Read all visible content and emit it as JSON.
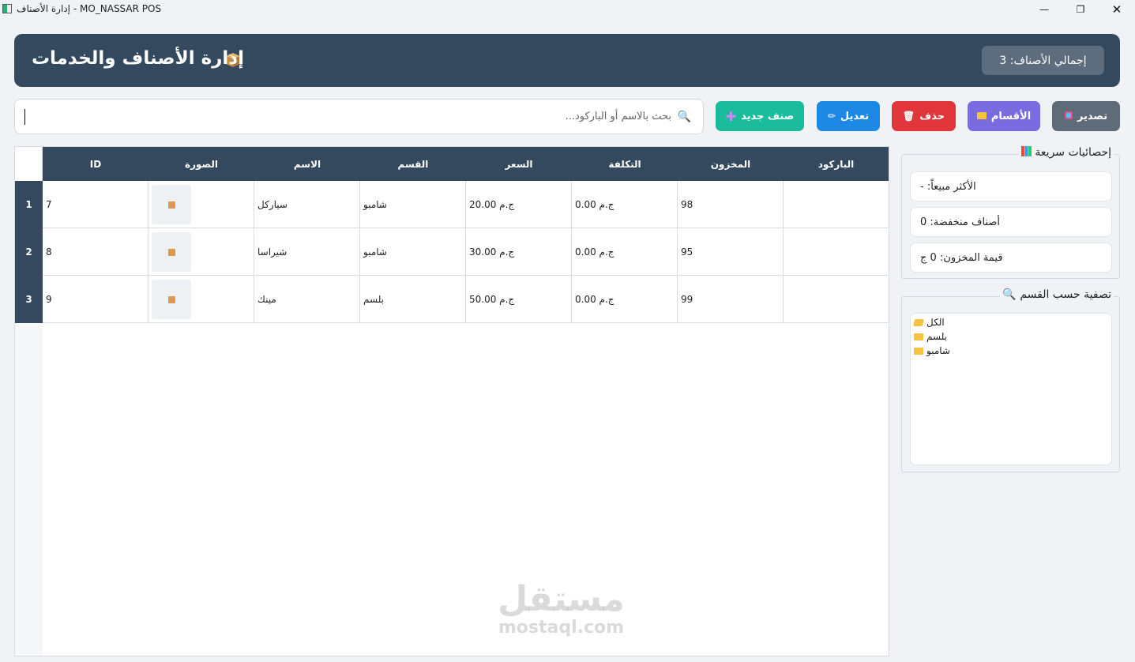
{
  "window": {
    "title": "إدارة الأصناف - MO_NASSAR POS"
  },
  "header": {
    "title": "إدارة الأصناف والخدمات",
    "total_label": "إجمالي الأصناف: 3"
  },
  "toolbar": {
    "search_placeholder": "بحث بالاسم أو الباركود...",
    "new_label": "صنف جديد",
    "edit_label": "تعديل",
    "delete_label": "حذف",
    "categories_label": "الأقسام",
    "export_label": "تصدير"
  },
  "table": {
    "columns": [
      "ID",
      "الصورة",
      "الاسم",
      "القسم",
      "السعر",
      "التكلفة",
      "المخزون",
      "الباركود"
    ],
    "rows": [
      {
        "num": "1",
        "id": "7",
        "name": "سياركل",
        "category": "شامبو",
        "price": "ج.م 20.00",
        "cost": "ج.م 0.00",
        "stock": "98",
        "barcode": ""
      },
      {
        "num": "2",
        "id": "8",
        "name": "شيراسا",
        "category": "شامبو",
        "price": "ج.م 30.00",
        "cost": "ج.م 0.00",
        "stock": "95",
        "barcode": ""
      },
      {
        "num": "3",
        "id": "9",
        "name": "مينك",
        "category": "بلسم",
        "price": "ج.م 50.00",
        "cost": "ج.م 0.00",
        "stock": "99",
        "barcode": ""
      }
    ]
  },
  "stats": {
    "title": "إحصائيات سريعة",
    "best_seller": "الأكثر مبيعاً: -",
    "low_stock": "أصناف منخفضة: 0",
    "stock_value": "قيمة المخزون: 0 ج"
  },
  "filter": {
    "title": "تصفية حسب القسم",
    "items": [
      "الكل",
      "بلسم",
      "شامبو"
    ]
  },
  "watermark": {
    "big": "مستقل",
    "small": "mostaql.com"
  }
}
